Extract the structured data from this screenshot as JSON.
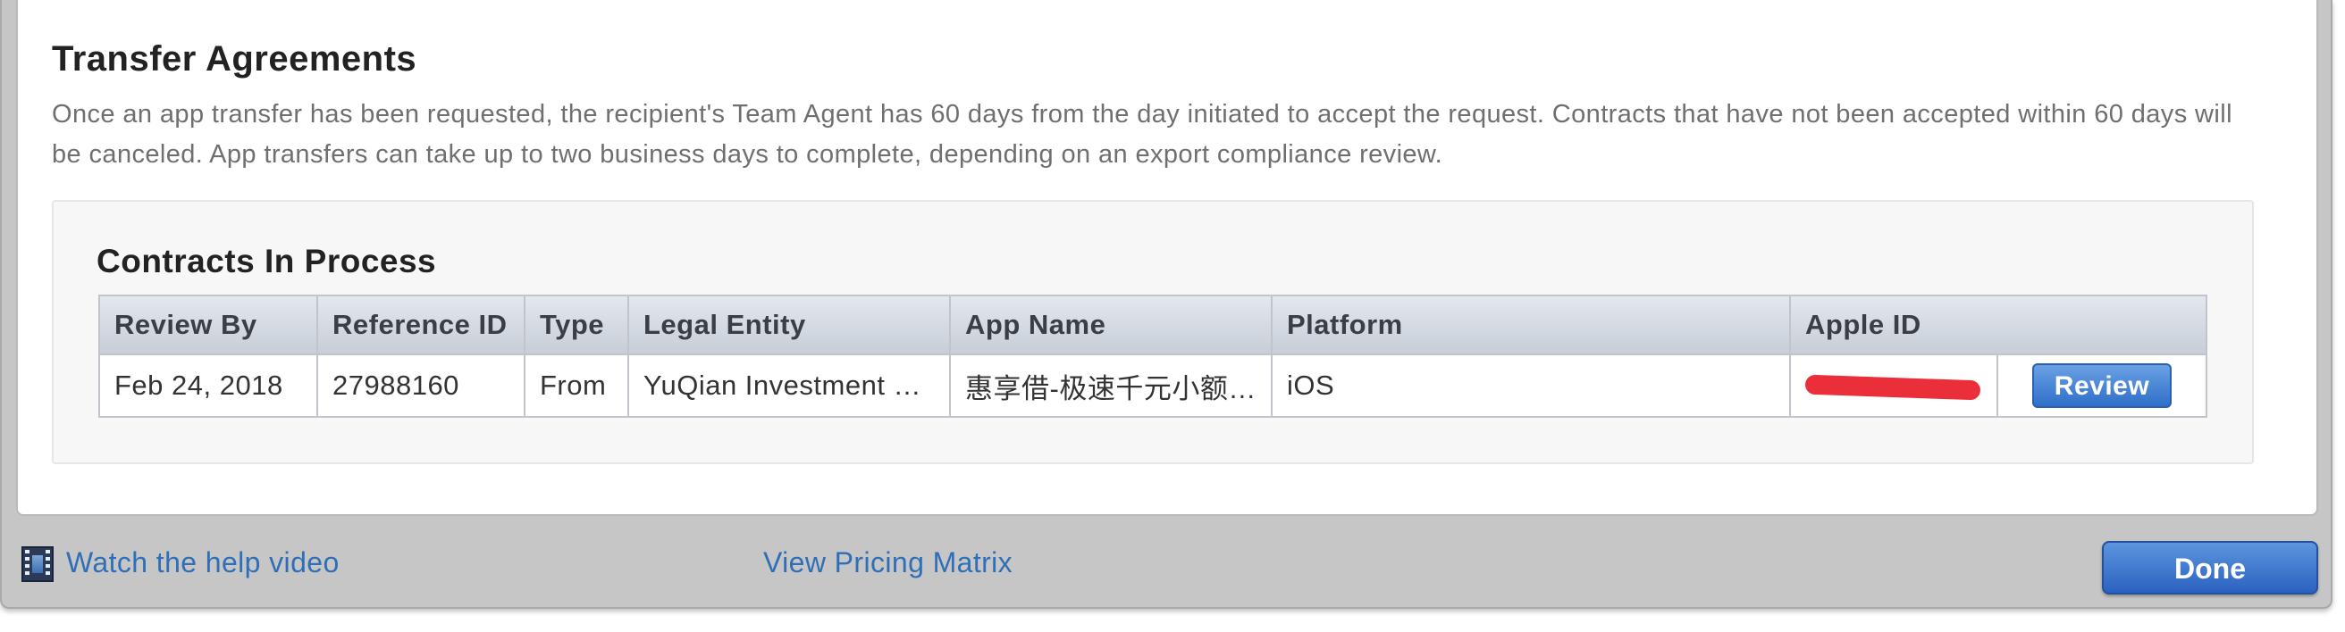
{
  "section": {
    "title": "Transfer Agreements",
    "description": "Once an app transfer has been requested, the recipient's Team Agent has 60 days from the day initiated to accept the request. Contracts that have not been accepted within 60 days will be canceled. App transfers can take up to two business days to complete, depending on an export compliance review."
  },
  "contracts": {
    "title": "Contracts In Process",
    "columns": [
      "Review By",
      "Reference ID",
      "Type",
      "Legal Entity",
      "App Name",
      "Platform",
      "Apple ID"
    ],
    "rows": [
      {
        "review_by": "Feb 24, 2018",
        "reference_id": "27988160",
        "type": "From",
        "legal_entity": "YuQian Investment …",
        "app_name": "惠享借-极速千元小额…",
        "platform": "iOS",
        "apple_id": "",
        "action_label": "Review"
      }
    ]
  },
  "footer": {
    "help_video_label": "Watch the help video",
    "pricing_matrix_label": "View Pricing Matrix",
    "done_label": "Done"
  },
  "colors": {
    "link": "#2f6fb7",
    "button": "#2f6fc9",
    "redaction": "#ea2f3a"
  }
}
